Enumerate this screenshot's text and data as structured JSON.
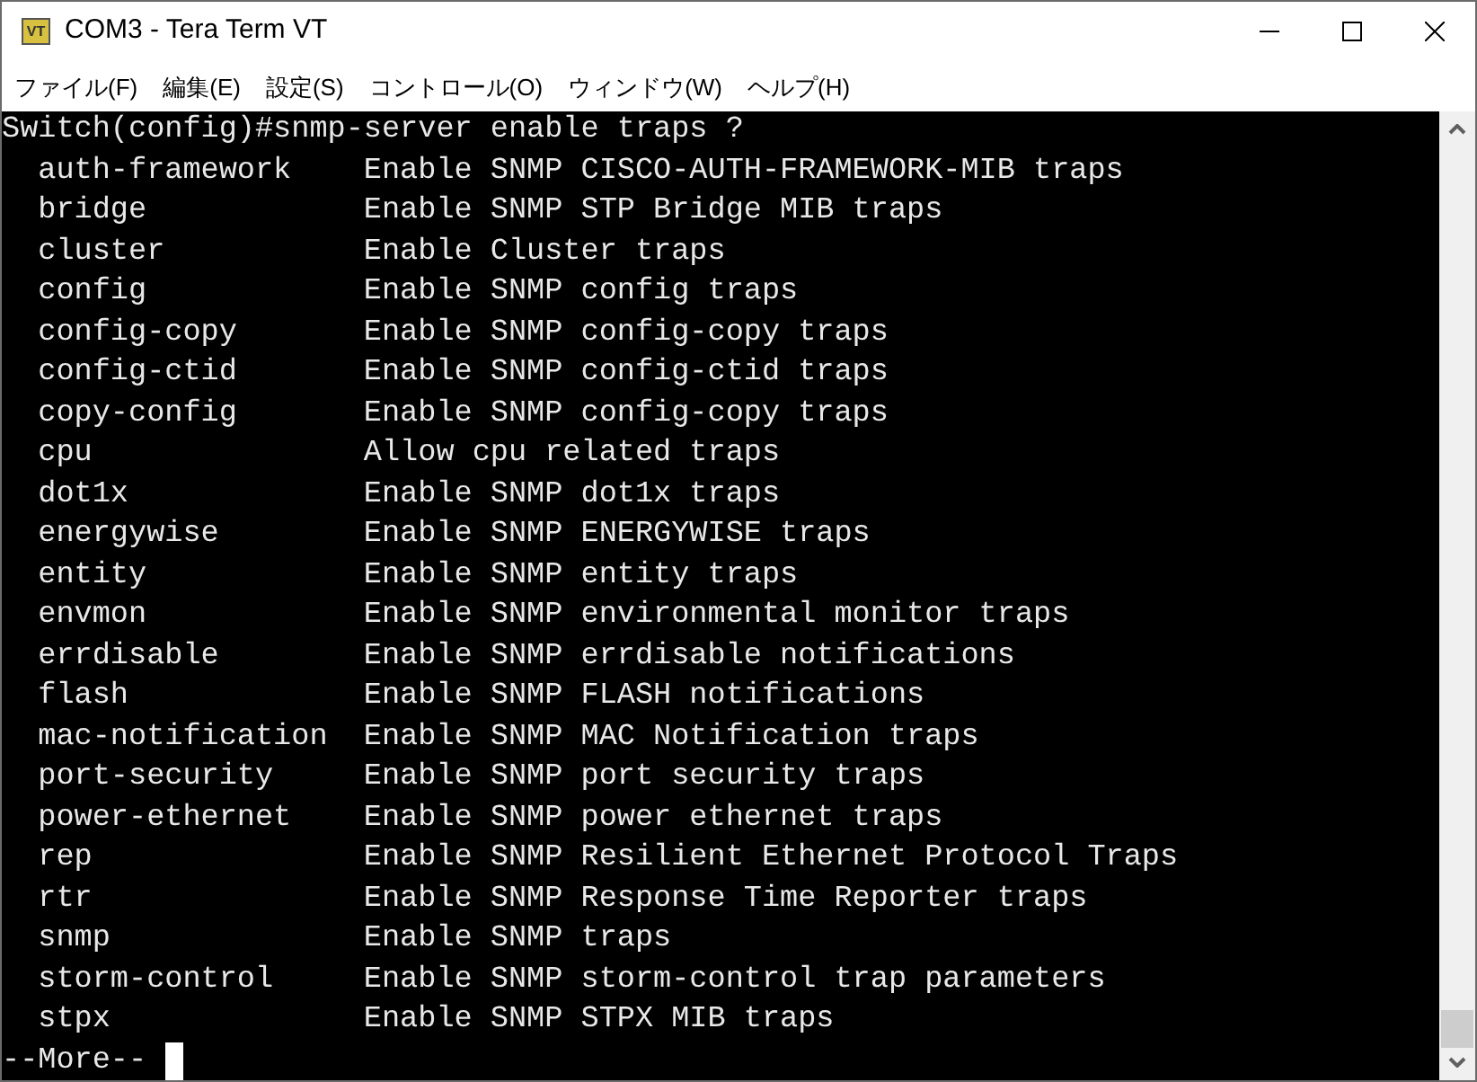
{
  "window": {
    "title": "COM3 - Tera Term VT",
    "app_icon_text": "VT"
  },
  "menu": [
    "ファイル(F)",
    "編集(E)",
    "設定(S)",
    "コントロール(O)",
    "ウィンドウ(W)",
    "ヘルプ(H)"
  ],
  "terminal": {
    "command_line": "Switch(config)#snmp-server enable traps ?",
    "entries": [
      {
        "name": "auth-framework",
        "description": "Enable SNMP CISCO-AUTH-FRAMEWORK-MIB traps"
      },
      {
        "name": "bridge",
        "description": "Enable SNMP STP Bridge MIB traps"
      },
      {
        "name": "cluster",
        "description": "Enable Cluster traps"
      },
      {
        "name": "config",
        "description": "Enable SNMP config traps"
      },
      {
        "name": "config-copy",
        "description": "Enable SNMP config-copy traps"
      },
      {
        "name": "config-ctid",
        "description": "Enable SNMP config-ctid traps"
      },
      {
        "name": "copy-config",
        "description": "Enable SNMP config-copy traps"
      },
      {
        "name": "cpu",
        "description": "Allow cpu related traps"
      },
      {
        "name": "dot1x",
        "description": "Enable SNMP dot1x traps"
      },
      {
        "name": "energywise",
        "description": "Enable SNMP ENERGYWISE traps"
      },
      {
        "name": "entity",
        "description": "Enable SNMP entity traps"
      },
      {
        "name": "envmon",
        "description": "Enable SNMP environmental monitor traps"
      },
      {
        "name": "errdisable",
        "description": "Enable SNMP errdisable notifications"
      },
      {
        "name": "flash",
        "description": "Enable SNMP FLASH notifications"
      },
      {
        "name": "mac-notification",
        "description": "Enable SNMP MAC Notification traps"
      },
      {
        "name": "port-security",
        "description": "Enable SNMP port security traps"
      },
      {
        "name": "power-ethernet",
        "description": "Enable SNMP power ethernet traps"
      },
      {
        "name": "rep",
        "description": "Enable SNMP Resilient Ethernet Protocol Traps"
      },
      {
        "name": "rtr",
        "description": "Enable SNMP Response Time Reporter traps"
      },
      {
        "name": "snmp",
        "description": "Enable SNMP traps"
      },
      {
        "name": "storm-control",
        "description": "Enable SNMP storm-control trap parameters"
      },
      {
        "name": "stpx",
        "description": "Enable SNMP STPX MIB traps"
      }
    ],
    "more_prompt": "--More--",
    "cursor": true
  }
}
